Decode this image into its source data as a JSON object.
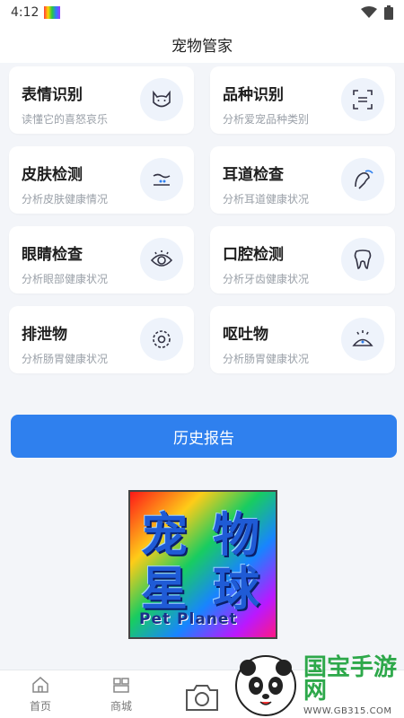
{
  "status_bar": {
    "time": "4:12",
    "wifi_icon": "wifi-icon",
    "battery_icon": "battery-icon"
  },
  "header": {
    "title": "宠物管家"
  },
  "features": [
    {
      "title": "表情识别",
      "subtitle": "读懂它的喜怒哀乐",
      "icon": "cat-face-icon"
    },
    {
      "title": "品种识别",
      "subtitle": "分析爱宠品种类别",
      "icon": "scan-icon"
    },
    {
      "title": "皮肤检测",
      "subtitle": "分析皮肤健康情况",
      "icon": "skin-icon"
    },
    {
      "title": "耳道检查",
      "subtitle": "分析耳道健康状况",
      "icon": "ear-icon"
    },
    {
      "title": "眼睛检查",
      "subtitle": "分析眼部健康状况",
      "icon": "eye-icon"
    },
    {
      "title": "口腔检测",
      "subtitle": "分析牙齿健康状况",
      "icon": "tooth-icon"
    },
    {
      "title": "排泄物",
      "subtitle": "分析肠胃健康状况",
      "icon": "gear-icon"
    },
    {
      "title": "呕吐物",
      "subtitle": "分析肠胃健康状况",
      "icon": "vomit-icon"
    }
  ],
  "history_button": {
    "label": "历史报告"
  },
  "logo": {
    "chars": [
      "宠",
      "物",
      "星",
      "球"
    ],
    "english": "Pet Planet"
  },
  "tabbar": {
    "items": [
      {
        "label": "首页",
        "icon": "home-icon"
      },
      {
        "label": "商城",
        "icon": "shop-icon"
      }
    ],
    "camera_icon": "camera-icon"
  },
  "watermark": {
    "title": "国宝手游网",
    "url": "WWW.GB315.COM"
  },
  "colors": {
    "primary": "#2f80ee",
    "background": "#f3f5f9",
    "icon_bg": "#eef3fb"
  }
}
